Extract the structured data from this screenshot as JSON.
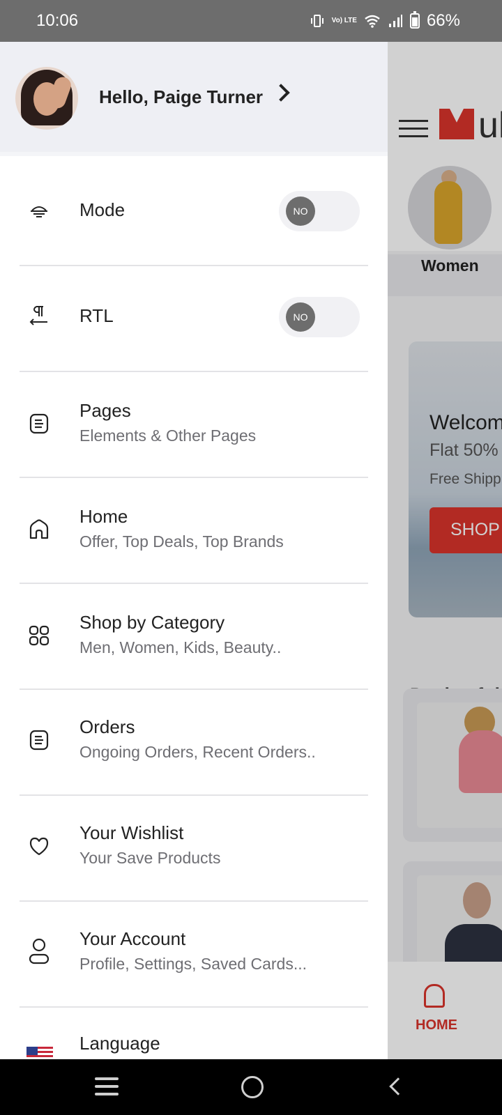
{
  "status_bar": {
    "time": "10:06",
    "battery": "66%",
    "lte_label": "Vo) LTE"
  },
  "background": {
    "logo_text": "ul",
    "category_label": "Women",
    "banner_title": "Welcom",
    "banner_offer": "Flat 50%",
    "banner_shipping": "Free Shipp",
    "banner_button": "SHOP",
    "deals_heading": "Deals of th",
    "nav_home_label": "HOME",
    "accent_color": "#d9342b"
  },
  "drawer": {
    "greeting": "Hello, Paige Turner",
    "toggles": [
      {
        "label": "Mode",
        "state": "NO"
      },
      {
        "label": "RTL",
        "state": "NO"
      }
    ],
    "items": [
      {
        "title": "Pages",
        "subtitle": "Elements & Other Pages",
        "icon": "document-icon"
      },
      {
        "title": "Home",
        "subtitle": "Offer, Top Deals, Top Brands",
        "icon": "home-icon"
      },
      {
        "title": "Shop by Category",
        "subtitle": "Men, Women, Kids, Beauty..",
        "icon": "grid-icon"
      },
      {
        "title": "Orders",
        "subtitle": "Ongoing Orders, Recent Orders..",
        "icon": "document-icon"
      },
      {
        "title": "Your Wishlist",
        "subtitle": "Your Save Products",
        "icon": "heart-icon"
      },
      {
        "title": "Your Account",
        "subtitle": "Profile, Settings, Saved Cards...",
        "icon": "user-icon"
      },
      {
        "title": "Language",
        "subtitle": "",
        "icon": "us-flag-icon"
      }
    ]
  }
}
